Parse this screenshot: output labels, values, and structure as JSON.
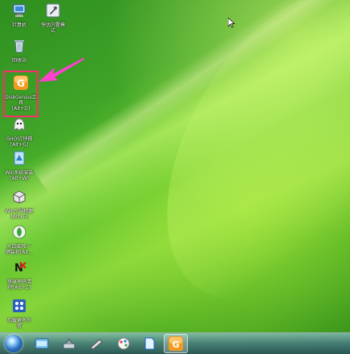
{
  "desktop_icons": [
    {
      "label": "計算机"
    },
    {
      "label": "快优内置模\n式"
    },
    {
      "label": "回收站"
    },
    {
      "label": "DiskGenius工具\n[Alt+D]"
    },
    {
      "label": "GHOST快照\n[Alt+G]"
    },
    {
      "label": "Win系统安装\n[Alt+W]"
    },
    {
      "label": "Win引导修复\n[Alt+F]"
    },
    {
      "label": "大白菜PE一\n键装机[Alt..."
    },
    {
      "label": "登录密码清\n除[Alt+C]"
    },
    {
      "label": "加载更多外\n置"
    }
  ],
  "icons_semantic": [
    "computer-icon",
    "settings-icon",
    "recycle-bin-icon",
    "diskgenius-icon",
    "ghost-icon",
    "win-install-icon",
    "boot-repair-icon",
    "pe-install-icon",
    "password-clear-icon",
    "load-more-icon"
  ],
  "annotation": {
    "box_color": "#ff2b6e",
    "arrow_color": "#ff3fd0"
  },
  "taskbar": {
    "start_icon": "windows-orb-icon",
    "items": [
      "explorer-icon",
      "network-icon",
      "pen-icon",
      "paint-icon",
      "doc-icon",
      "diskgenius-taskbar-icon"
    ]
  }
}
